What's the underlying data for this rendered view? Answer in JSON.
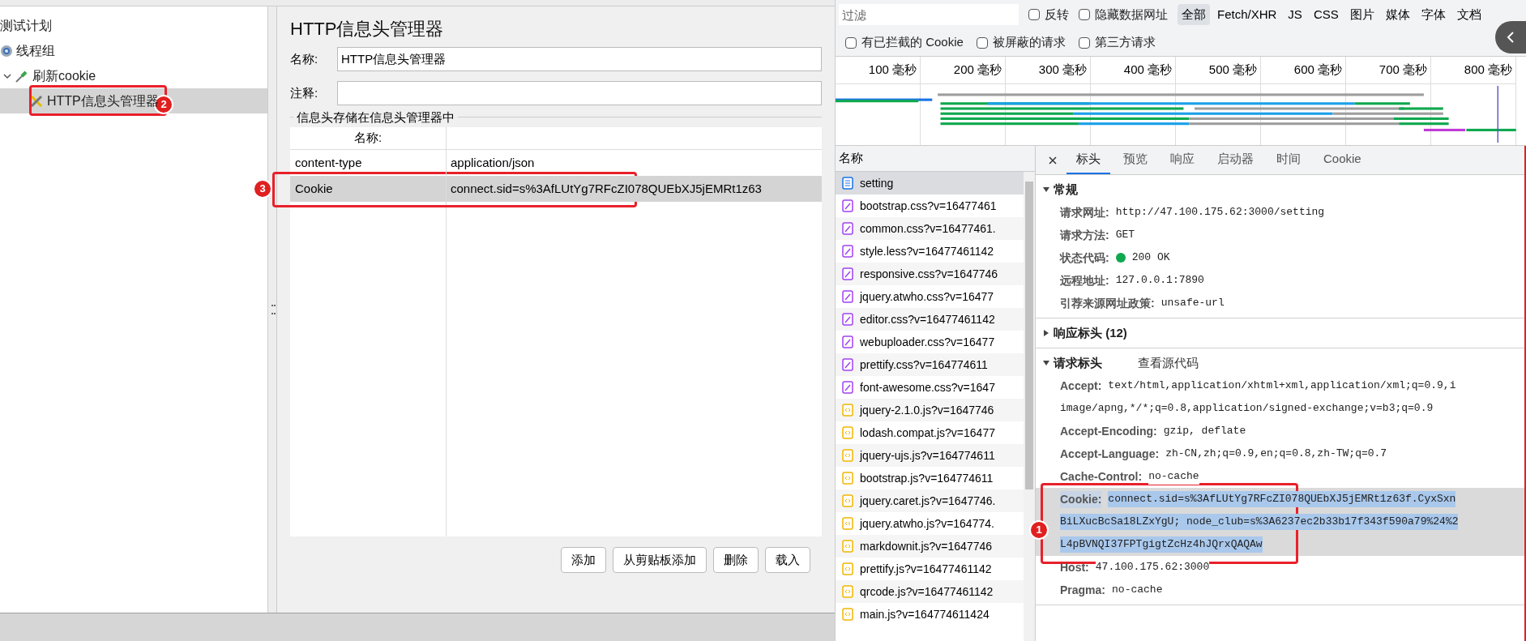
{
  "jmeter": {
    "tree": [
      {
        "label": "测试计划",
        "selected": false,
        "children": [
          {
            "label": "线程组",
            "kind": "group",
            "selected": false,
            "children": [
              {
                "label": "刷新cookie",
                "kind": "preprocessor",
                "expanded": true,
                "selected": false,
                "children": [
                  {
                    "label": "HTTP信息头管理器",
                    "kind": "config",
                    "selected": true,
                    "marker": "2"
                  }
                ]
              }
            ]
          }
        ]
      }
    ],
    "panel": {
      "title": "HTTP信息头管理器",
      "name_label": "名称:",
      "name_value": "HTTP信息头管理器",
      "comment_label": "注释:",
      "group_title": "信息头存储在信息头管理器中",
      "columns": [
        "名称:"
      ],
      "rows": [
        {
          "name": "content-type",
          "value": "application/json",
          "selected": false
        },
        {
          "name": "Cookie",
          "value": "connect.sid=s%3AfLUtYg7RFcZI078QUEbXJ5jEMRt1z63",
          "selected": true,
          "marker": "3"
        }
      ],
      "buttons": [
        "添加",
        "从剪贴板添加",
        "删除",
        "载入"
      ]
    }
  },
  "devtools": {
    "filter": {
      "placeholder": "过滤"
    },
    "options": [
      {
        "label": "反转",
        "checked": false
      },
      {
        "label": "隐藏数据网址",
        "checked": false
      }
    ],
    "types": [
      {
        "label": "全部",
        "selected": true
      },
      {
        "label": "Fetch/XHR",
        "selected": false
      },
      {
        "label": "JS",
        "selected": false
      },
      {
        "label": "CSS",
        "selected": false
      },
      {
        "label": "图片",
        "selected": false
      },
      {
        "label": "媒体",
        "selected": false
      },
      {
        "label": "字体",
        "selected": false
      },
      {
        "label": "文档",
        "selected": false
      }
    ],
    "options_2": [
      {
        "label": "有已拦截的 Cookie",
        "checked": false
      },
      {
        "label": "被屏蔽的请求",
        "checked": false
      },
      {
        "label": "第三方请求",
        "checked": false
      }
    ],
    "timeline_ticks": [
      "100 毫秒",
      "200 毫秒",
      "300 毫秒",
      "400 毫秒",
      "500 毫秒",
      "600 毫秒",
      "700 毫秒",
      "800 毫秒"
    ],
    "list_header": "名称",
    "requests": [
      {
        "name": "setting",
        "kind": "document",
        "selected": true
      },
      {
        "name": "bootstrap.css?v=16477461",
        "kind": "stylesheet",
        "selected": false
      },
      {
        "name": "common.css?v=16477461.",
        "kind": "stylesheet",
        "selected": false
      },
      {
        "name": "style.less?v=16477461142",
        "kind": "stylesheet",
        "selected": false
      },
      {
        "name": "responsive.css?v=1647746",
        "kind": "stylesheet",
        "selected": false
      },
      {
        "name": "jquery.atwho.css?v=16477",
        "kind": "stylesheet",
        "selected": false
      },
      {
        "name": "editor.css?v=16477461142",
        "kind": "stylesheet",
        "selected": false
      },
      {
        "name": "webuploader.css?v=16477",
        "kind": "stylesheet",
        "selected": false
      },
      {
        "name": "prettify.css?v=164774611",
        "kind": "stylesheet",
        "selected": false
      },
      {
        "name": "font-awesome.css?v=1647",
        "kind": "stylesheet",
        "selected": false
      },
      {
        "name": "jquery-2.1.0.js?v=1647746",
        "kind": "script",
        "selected": false
      },
      {
        "name": "lodash.compat.js?v=16477",
        "kind": "script",
        "selected": false
      },
      {
        "name": "jquery-ujs.js?v=164774611",
        "kind": "script",
        "selected": false
      },
      {
        "name": "bootstrap.js?v=164774611",
        "kind": "script",
        "selected": false
      },
      {
        "name": "jquery.caret.js?v=1647746.",
        "kind": "script",
        "selected": false
      },
      {
        "name": "jquery.atwho.js?v=164774.",
        "kind": "script",
        "selected": false
      },
      {
        "name": "markdownit.js?v=1647746",
        "kind": "script",
        "selected": false
      },
      {
        "name": "prettify.js?v=16477461142",
        "kind": "script",
        "selected": false
      },
      {
        "name": "qrcode.js?v=16477461142",
        "kind": "script",
        "selected": false
      },
      {
        "name": "main.js?v=164774611424",
        "kind": "script",
        "selected": false
      }
    ],
    "tabs": [
      {
        "label": "标头",
        "selected": true
      },
      {
        "label": "预览",
        "selected": false
      },
      {
        "label": "响应",
        "selected": false
      },
      {
        "label": "启动器",
        "selected": false
      },
      {
        "label": "时间",
        "selected": false
      },
      {
        "label": "Cookie",
        "selected": false
      }
    ],
    "sections": [
      {
        "title": "常规",
        "expanded": true,
        "rows": [
          {
            "label": "请求网址:",
            "value": [
              "http://47.100.175.62:3000/setting"
            ]
          },
          {
            "label": "请求方法:",
            "value": [
              "GET"
            ]
          },
          {
            "label": "状态代码:",
            "value": [
              "200 OK"
            ],
            "status_dot": true
          },
          {
            "label": "远程地址:",
            "value": [
              "127.0.0.1:7890"
            ]
          },
          {
            "label": "引荐来源网址政策:",
            "value": [
              "unsafe-url"
            ]
          }
        ]
      },
      {
        "title": "响应标头 (12)",
        "expanded": false
      },
      {
        "title": "请求标头",
        "expanded": true,
        "link": "查看源代码",
        "rows": [
          {
            "label": "Accept:",
            "value": [
              "text/html,application/xhtml+xml,application/xml;q=0.9,i",
              "image/apng,*/*;q=0.8,application/signed-exchange;v=b3;q=0.9"
            ]
          },
          {
            "label": "Accept-Encoding:",
            "value": [
              "gzip, deflate"
            ]
          },
          {
            "label": "Accept-Language:",
            "value": [
              "zh-CN,zh;q=0.9,en;q=0.8,zh-TW;q=0.7"
            ]
          },
          {
            "label": "Cache-Control:",
            "value": [
              "no-cache"
            ]
          },
          {
            "label": "Cookie:",
            "selected": true,
            "marker": "1",
            "value": [
              "connect.sid=s%3AfLUtYg7RFcZI078QUEbXJ5jEMRt1z63f.CyxSxn",
              "BiLXucBcSa18LZxYgU; node_club=s%3A6237ec2b33b17f343f590a79%24%2",
              "L4pBVNQI37FPTgigtZcHz4hJQrxQAQAw"
            ]
          },
          {
            "label": "Host:",
            "value": [
              "47.100.175.62:3000"
            ]
          },
          {
            "label": "Pragma:",
            "value": [
              "no-cache"
            ]
          }
        ]
      }
    ]
  }
}
